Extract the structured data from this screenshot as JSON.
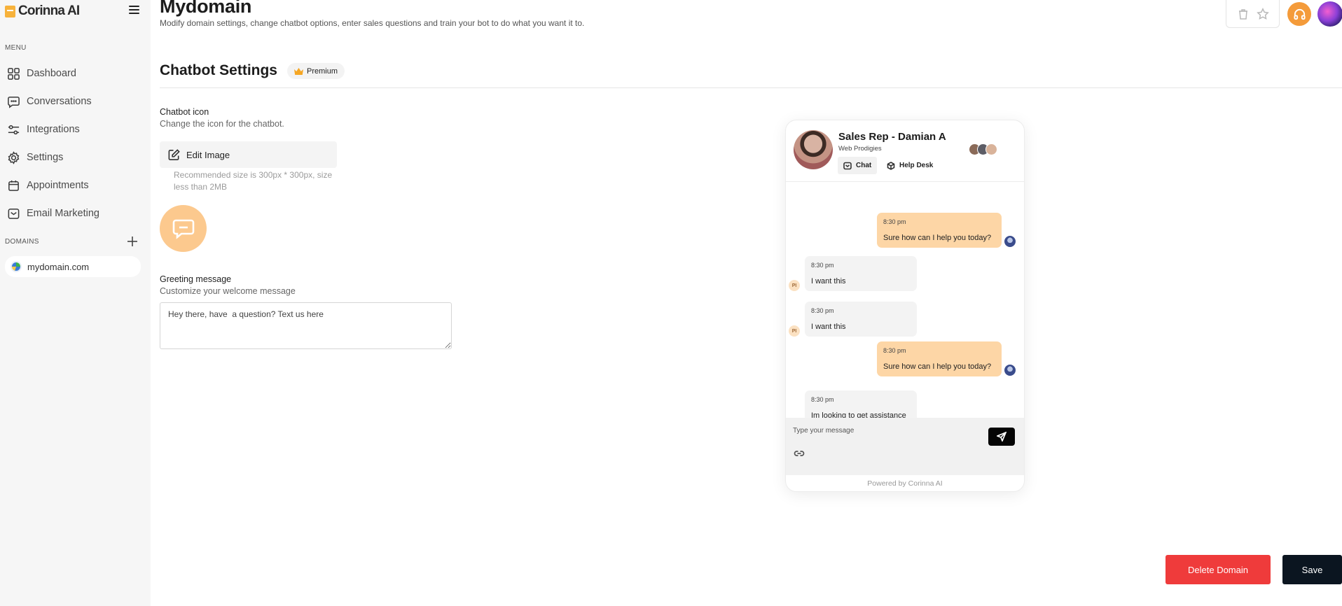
{
  "brand": {
    "name": "Corinna AI"
  },
  "sidebar": {
    "menu_label": "MENU",
    "items": [
      {
        "label": "Dashboard",
        "icon": "dashboard-icon"
      },
      {
        "label": "Conversations",
        "icon": "chat-icon"
      },
      {
        "label": "Integrations",
        "icon": "sliders-icon"
      },
      {
        "label": "Settings",
        "icon": "gear-icon"
      },
      {
        "label": "Appointments",
        "icon": "calendar-icon"
      },
      {
        "label": "Email Marketing",
        "icon": "mail-icon"
      }
    ],
    "domains_label": "DOMAINS",
    "domains": [
      {
        "label": "mydomain.com"
      }
    ]
  },
  "header": {
    "title": "Mydomain",
    "subtitle": "Modify domain settings, change chatbot options, enter sales questions and train your bot to do what you want it to."
  },
  "settings": {
    "section_title": "Chatbot Settings",
    "premium_badge": "Premium",
    "chatbot_icon_label": "Chatbot icon",
    "chatbot_icon_help": "Change the icon for the chatbot.",
    "edit_image_label": "Edit Image",
    "size_note": "Recommended size is 300px * 300px, size less than 2MB",
    "greeting_label": "Greeting message",
    "greeting_help": "Customize your welcome message",
    "greeting_value": "Hey there, have  a question? Text us here"
  },
  "chat_preview": {
    "agent_name": "Sales Rep - Damian A",
    "agent_company": "Web Prodigies",
    "tabs": [
      {
        "label": "Chat"
      },
      {
        "label": "Help Desk"
      }
    ],
    "messages": [
      {
        "role": "bot",
        "time": "8:30 pm",
        "text": "Sure how can I help you today?"
      },
      {
        "role": "user",
        "time": "8:30 pm",
        "text": "I want this",
        "avatar": "PI"
      },
      {
        "role": "user",
        "time": "8:30 pm",
        "text": "I want this",
        "avatar": "PI"
      },
      {
        "role": "bot",
        "time": "8:30 pm",
        "text": "Sure how can I help you today?"
      },
      {
        "role": "user",
        "time": "8:30 pm",
        "text": "Im looking to get assistance"
      }
    ],
    "input_placeholder": "Type your message",
    "powered_by": "Powered by Corinna AI"
  },
  "actions": {
    "delete_label": "Delete Domain",
    "save_label": "Save"
  },
  "colors": {
    "accent": "#f49b3a",
    "bot_bubble": "#fdd6a6",
    "delete": "#ef3b3b",
    "save": "#0b1520"
  }
}
